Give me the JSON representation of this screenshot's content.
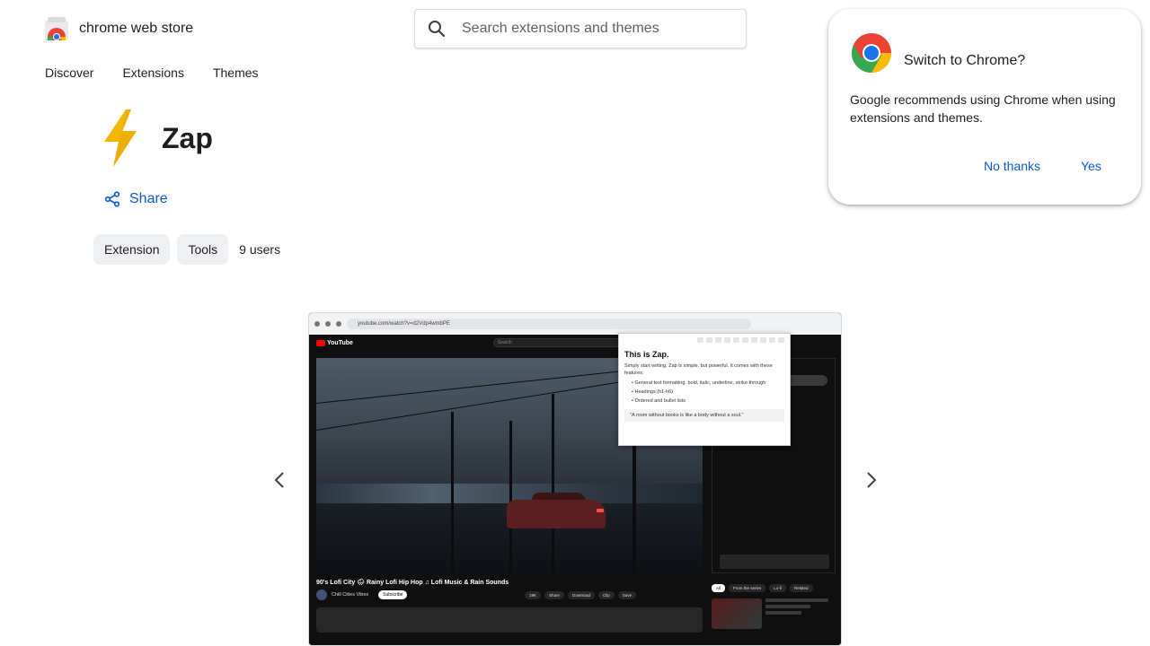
{
  "header": {
    "store_name": "chrome web store",
    "search_placeholder": "Search extensions and themes"
  },
  "nav": {
    "items": [
      "Discover",
      "Extensions",
      "Themes"
    ]
  },
  "extension": {
    "title": "Zap",
    "share_label": "Share",
    "chips": [
      "Extension",
      "Tools"
    ],
    "users": "9 users"
  },
  "screenshot": {
    "url": "youtube.com/watch?v=d2Vdp4wmbPE",
    "yt_brand": "YouTube",
    "yt_search": "Search",
    "zap_heading": "This is Zap.",
    "zap_intro": "Simply start writing. Zap is simple, but powerful. It comes with these features:",
    "zap_features": [
      "General text formatting: bold, italic, underline, strike-through",
      "Headings (h1-h6)",
      "Ordered and bullet lists"
    ],
    "zap_quote": "\"A room without books is like a body without a soul.\"",
    "video_title": "90's Lofi City 🌧 Rainy Lofi Hip Hop ♫ Lofi Music & Rain Sounds",
    "channel_name": "Chill Cities Vibes",
    "subscribe": "Subscribe",
    "actions": [
      "19K",
      "Share",
      "Download",
      "Clip",
      "Save"
    ],
    "related_tabs": [
      "All",
      "From the series",
      "Lo-fi",
      "Related"
    ]
  },
  "popup": {
    "title": "Switch to Chrome?",
    "body": "Google recommends using Chrome when using extensions and themes.",
    "no_label": "No thanks",
    "yes_label": "Yes"
  },
  "colors": {
    "accent": "#0b57d0",
    "chip_bg": "#eef0f3",
    "zap_bolt": "#f5b800"
  }
}
